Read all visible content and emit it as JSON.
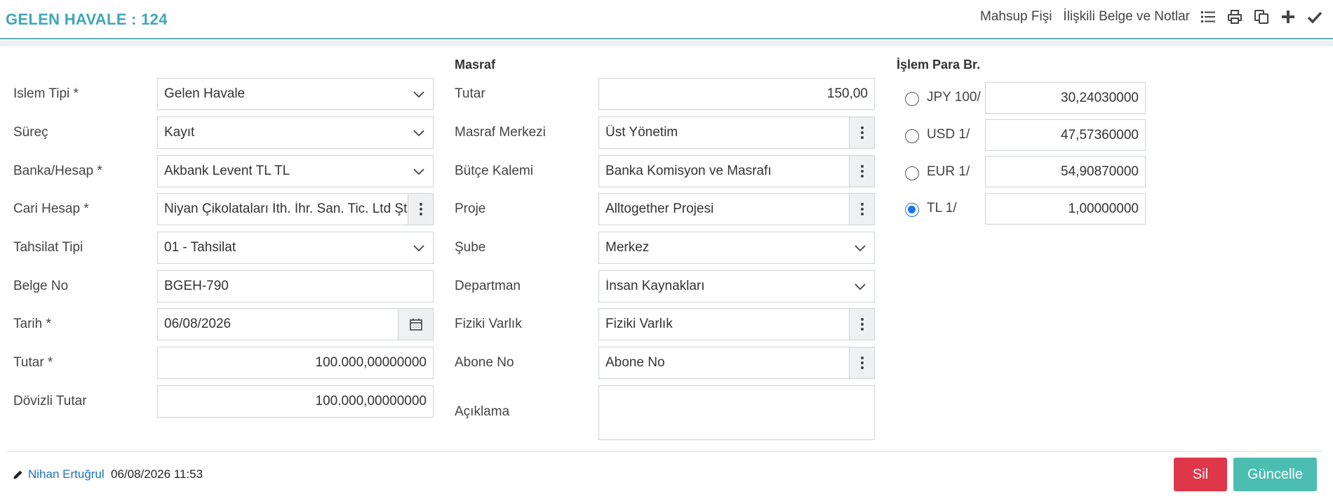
{
  "header": {
    "title": "GELEN HAVALE : 124",
    "links": [
      "Mahsup Fişi",
      "İlişkili Belge ve Notlar"
    ],
    "icons": [
      "list-icon",
      "print-icon",
      "copy-icon",
      "plus-icon",
      "check-icon"
    ]
  },
  "left": {
    "rows": [
      {
        "label": "Islem Tipi *",
        "value": "Gelen Havale",
        "kind": "select"
      },
      {
        "label": "Süreç",
        "value": "Kayıt",
        "kind": "select"
      },
      {
        "label": "Banka/Hesap *",
        "value": "Akbank Levent TL TL",
        "kind": "select"
      },
      {
        "label": "Cari Hesap *",
        "value": "Niyan Çikolataları İth. İhr. San. Tic. Ltd Şti",
        "kind": "lookup"
      },
      {
        "label": "Tahsilat Tipi",
        "value": "01 - Tahsilat",
        "kind": "select"
      },
      {
        "label": "Belge No",
        "value": "BGEH-790",
        "kind": "text"
      },
      {
        "label": "Tarih *",
        "value": "06/08/2026",
        "kind": "date"
      },
      {
        "label": "Tutar *",
        "value": "100.000,00000000",
        "kind": "number"
      },
      {
        "label": "Dövizli Tutar",
        "value": "100.000,00000000",
        "kind": "number"
      }
    ]
  },
  "middle": {
    "section_title": "Masraf",
    "rows": [
      {
        "label": "Tutar",
        "value": "150,00",
        "kind": "number"
      },
      {
        "label": "Masraf Merkezi",
        "value": "Üst Yönetim",
        "kind": "lookup"
      },
      {
        "label": "Bütçe Kalemi",
        "value": "Banka Komisyon ve Masrafı",
        "kind": "lookup"
      },
      {
        "label": "Proje",
        "value": "Alltogether Projesi",
        "kind": "lookup"
      },
      {
        "label": "Şube",
        "value": "Merkez",
        "kind": "select"
      },
      {
        "label": "Departman",
        "value": "İnsan Kaynakları",
        "kind": "select"
      },
      {
        "label": "Fiziki Varlık",
        "value": "Fiziki Varlık",
        "kind": "lookup"
      },
      {
        "label": "Abone No",
        "value": "Abone No",
        "kind": "lookup"
      }
    ],
    "note_label": "Açıklama",
    "note_value": ""
  },
  "right": {
    "section_title": "İşlem Para Br.",
    "rates": [
      {
        "label": "JPY 100/",
        "value": "30,24030000",
        "selected": false
      },
      {
        "label": "USD 1/",
        "value": "47,57360000",
        "selected": false
      },
      {
        "label": "EUR 1/",
        "value": "54,90870000",
        "selected": false
      },
      {
        "label": "TL 1/",
        "value": "1,00000000",
        "selected": true
      }
    ]
  },
  "footer": {
    "user": "Nihan Ertuğrul",
    "datetime": "06/08/2026 11:53",
    "delete_label": "Sil",
    "update_label": "Güncelle"
  },
  "colors": {
    "title": "#3fa7b8",
    "accent_line": "#5fb7b5",
    "delete_button": "#e0364a",
    "update_button": "#4bbdb1",
    "radio_selected": "#1a73e8",
    "user_link": "#1a73b8"
  }
}
